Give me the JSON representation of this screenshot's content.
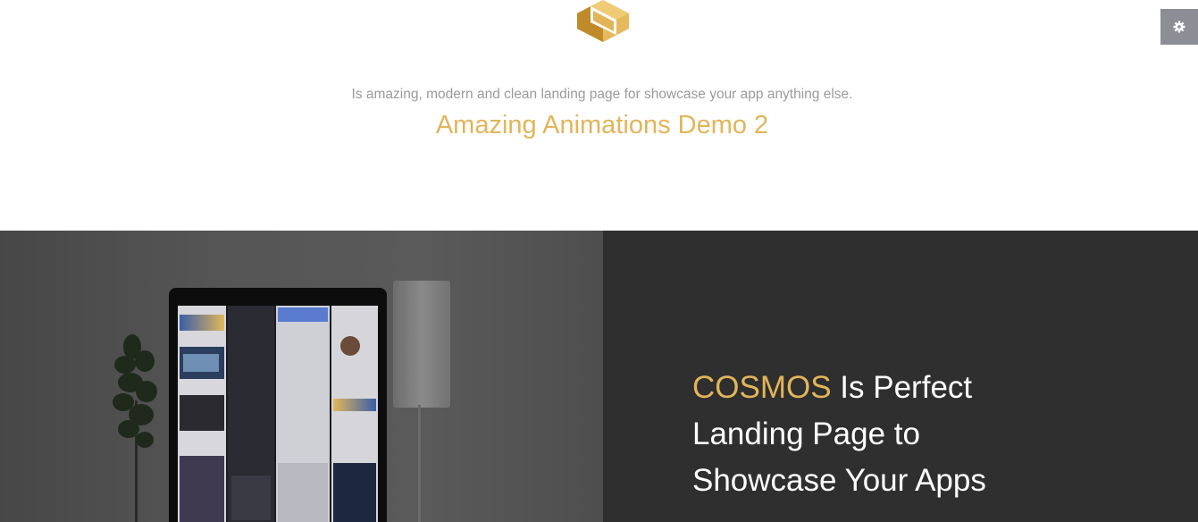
{
  "header": {
    "tagline": "Is amazing, modern and clean landing page for showcase your app anything else.",
    "demo_title": "Amazing Animations Demo 2"
  },
  "settings": {
    "icon": "gear-icon"
  },
  "hero": {
    "brand": "COSMOS",
    "heading_rest": " Is Perfect Landing Page to Showcase Your Apps"
  },
  "colors": {
    "accent": "#e2b55a",
    "dark_panel": "#2f2f2f",
    "settings_bg": "#8d8d95"
  }
}
